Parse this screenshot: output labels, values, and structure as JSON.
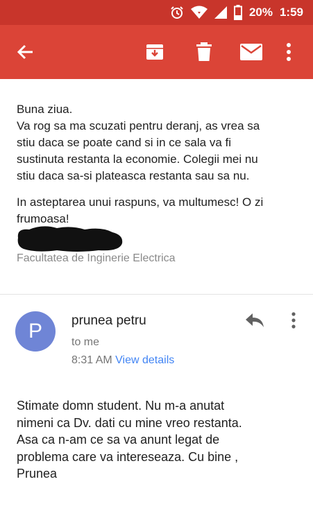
{
  "status_bar": {
    "battery_percent": "20%",
    "time": "1:59"
  },
  "icons": {
    "alarm": "alarm-icon",
    "wifi": "wifi-icon",
    "signal": "signal-icon",
    "battery": "battery-icon",
    "back": "back-arrow-icon",
    "archive": "archive-icon",
    "delete": "trash-icon",
    "mark_unread": "mail-icon",
    "more": "more-vert-icon",
    "reply": "reply-icon"
  },
  "colors": {
    "status_bar": "#c8352b",
    "app_bar": "#db4437",
    "avatar": "#6f85d6",
    "link": "#4285f4"
  },
  "first_message": {
    "lines": [
      "Buna ziua.",
      "Va rog sa ma scuzati pentru deranj, as vrea sa",
      "stiu daca se poate cand si in ce sala va fi",
      "sustinuta restanta la economie. Colegii mei nu",
      "stiu daca sa-si plateasca restanta sau sa nu."
    ],
    "closing_lines": [
      "In asteptarea unui raspuns, va multumesc! O zi",
      "frumoasa!"
    ],
    "signature": "Facultatea de Inginerie Electrica"
  },
  "reply_message": {
    "avatar_letter": "P",
    "sender": "prunea petru",
    "recipient": "to me",
    "time": "8:31 AM",
    "details_link": "View details",
    "body_lines": [
      "Stimate domn student. Nu m-a anutat",
      "nimeni ca Dv. dati cu mine  vreo restanta.",
      "Asa ca n-am ce sa va anunt legat de",
      "problema care va intereseaza. Cu bine ,",
      "Prunea"
    ]
  }
}
